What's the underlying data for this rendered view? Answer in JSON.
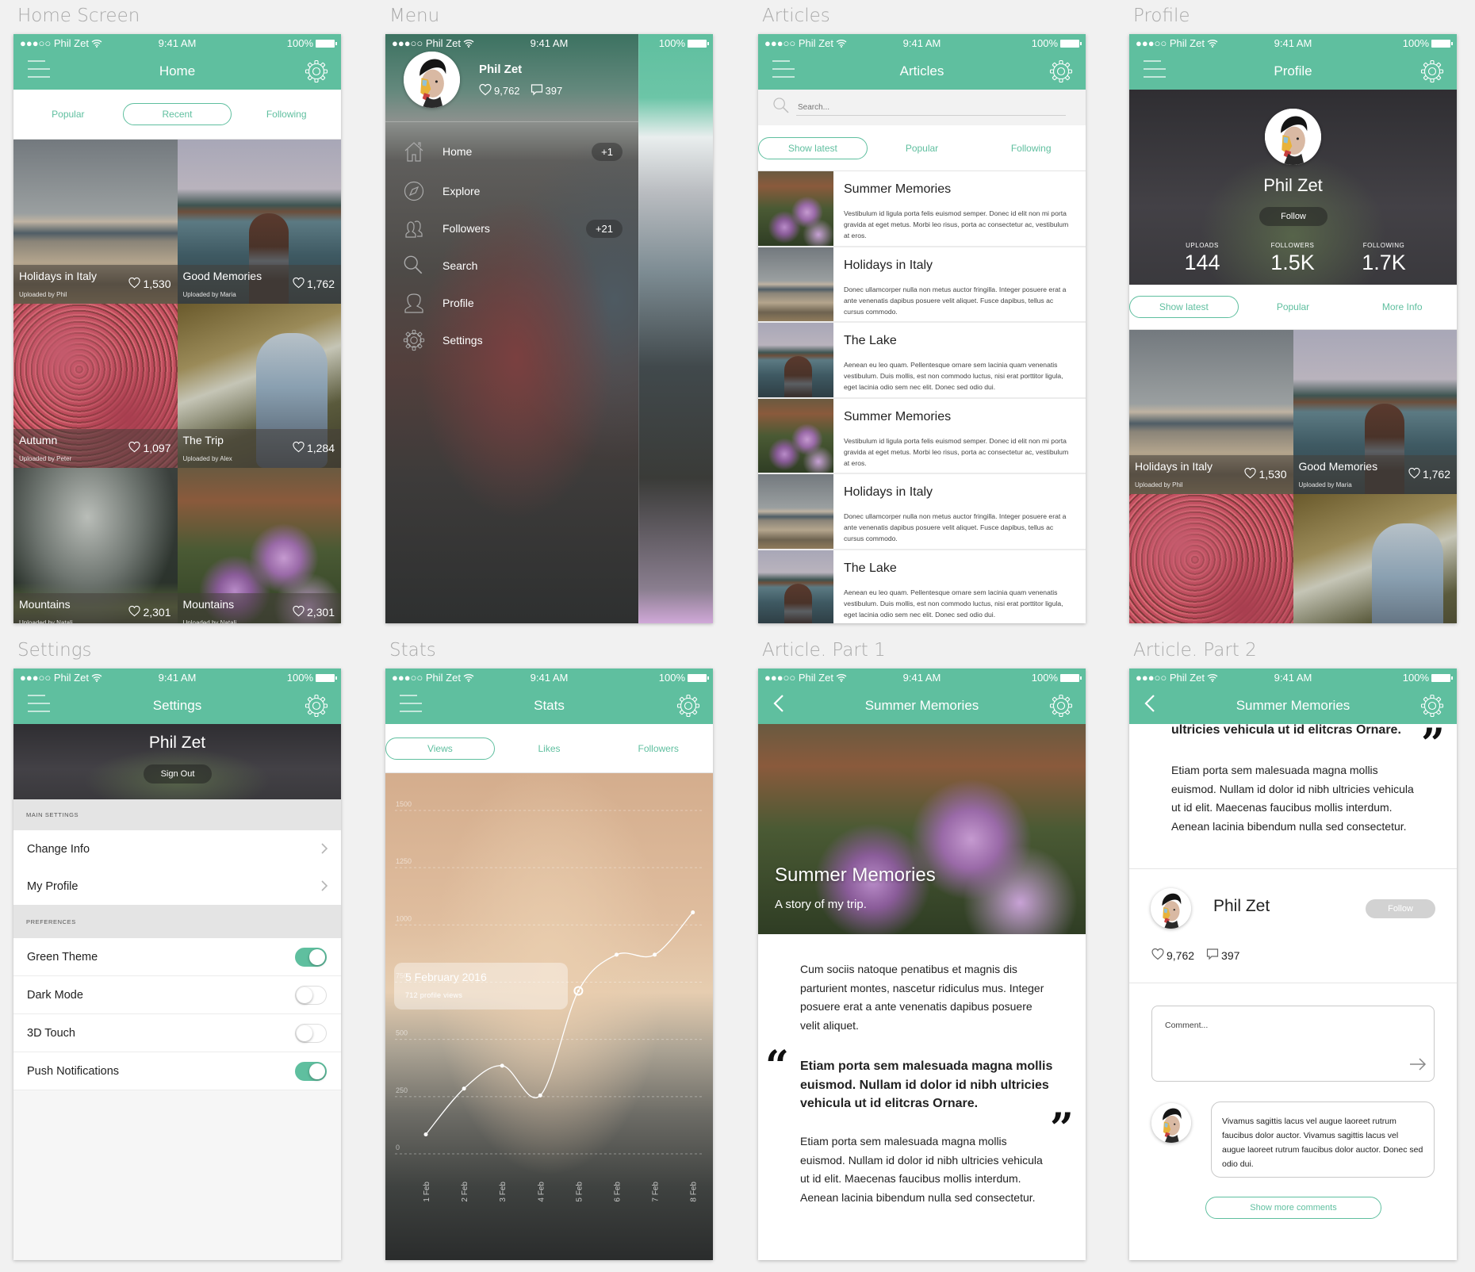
{
  "colors": {
    "accent": "#5fbf9f",
    "text": "#222222",
    "muted": "#a9a9a9"
  },
  "status": {
    "carrier": "●●●○○ Phil Zet",
    "time": "9:41 AM",
    "battery": "100%"
  },
  "user": {
    "name": "Phil Zet",
    "likes": "9,762",
    "comments": "397"
  },
  "home": {
    "label": "Home Screen",
    "title": "Home",
    "tabs": [
      "Popular",
      "Recent",
      "Following"
    ],
    "active_tab": "Recent",
    "cards": [
      {
        "title": "Holidays in Italy",
        "uploader": "Uploaded by Phil",
        "likes": "1,530",
        "photo": "italy"
      },
      {
        "title": "Good Memories",
        "uploader": "Uploaded by Maria",
        "likes": "1,762",
        "photo": "lake"
      },
      {
        "title": "Autumn",
        "uploader": "Uploaded by Peter",
        "likes": "1,097",
        "photo": "autumn"
      },
      {
        "title": "The Trip",
        "uploader": "Uploaded by Alex",
        "likes": "1,284",
        "photo": "trip"
      },
      {
        "title": "Mountains",
        "uploader": "Uploaded by Natali",
        "likes": "2,301",
        "photo": "mist"
      },
      {
        "title": "Mountains",
        "uploader": "Uploaded by Natali",
        "likes": "2,301",
        "photo": "flowers"
      }
    ]
  },
  "menu": {
    "label": "Menu",
    "items": [
      {
        "label": "Home",
        "icon": "home-icon",
        "badge": "+1"
      },
      {
        "label": "Explore",
        "icon": "compass-icon",
        "badge": ""
      },
      {
        "label": "Followers",
        "icon": "followers-icon",
        "badge": "+21"
      },
      {
        "label": "Search",
        "icon": "search-icon",
        "badge": ""
      },
      {
        "label": "Profile",
        "icon": "profile-icon",
        "badge": ""
      },
      {
        "label": "Settings",
        "icon": "gear-icon",
        "badge": ""
      }
    ]
  },
  "articles": {
    "label": "Articles",
    "title": "Articles",
    "search_placeholder": "Search...",
    "tabs": [
      "Show latest",
      "Popular",
      "Following"
    ],
    "active_tab": "Show latest",
    "items": [
      {
        "title": "Summer Memories",
        "text": "Vestibulum id ligula porta felis euismod semper. Donec id elit non mi porta gravida at eget metus. Morbi leo risus, porta ac consectetur ac, vestibulum at eros.",
        "photo": "flowers"
      },
      {
        "title": "Holidays in Italy",
        "text": "Donec ullamcorper nulla non metus auctor fringilla. Integer posuere erat a ante venenatis dapibus posuere velit aliquet. Fusce dapibus, tellus ac cursus commodo.",
        "photo": "italy"
      },
      {
        "title": "The Lake",
        "text": "Aenean eu leo quam. Pellentesque ornare sem lacinia quam venenatis vestibulum. Duis mollis, est non commodo luctus, nisi erat porttitor ligula, eget lacinia odio sem nec elit. Donec sed odio dui.",
        "photo": "lake"
      },
      {
        "title": "Summer Memories",
        "text": "Vestibulum id ligula porta felis euismod semper. Donec id elit non mi porta gravida at eget metus. Morbi leo risus, porta ac consectetur ac, vestibulum at eros.",
        "photo": "flowers"
      },
      {
        "title": "Holidays in Italy",
        "text": "Donec ullamcorper nulla non metus auctor fringilla. Integer posuere erat a ante venenatis dapibus posuere velit aliquet. Fusce dapibus, tellus ac cursus commodo.",
        "photo": "italy"
      },
      {
        "title": "The Lake",
        "text": "Aenean eu leo quam. Pellentesque ornare sem lacinia quam venenatis vestibulum. Duis mollis, est non commodo luctus, nisi erat porttitor ligula, eget lacinia odio sem nec elit. Donec sed odio dui.",
        "photo": "lake"
      }
    ]
  },
  "profile": {
    "label": "Profile",
    "title": "Profile",
    "follow": "Follow",
    "stats": [
      {
        "key": "UPLOADS",
        "value": "144"
      },
      {
        "key": "FOLLOWERS",
        "value": "1.5K"
      },
      {
        "key": "FOLLOWING",
        "value": "1.7K"
      }
    ],
    "tabs": [
      "Show latest",
      "Popular",
      "More Info"
    ],
    "active_tab": "Show latest",
    "cards": [
      {
        "title": "Holidays in Italy",
        "uploader": "Uploaded by Phil",
        "likes": "1,530",
        "photo": "italy"
      },
      {
        "title": "Good Memories",
        "uploader": "Uploaded by Maria",
        "likes": "1,762",
        "photo": "lake"
      },
      {
        "title": "",
        "uploader": "",
        "likes": "",
        "photo": "autumn"
      },
      {
        "title": "",
        "uploader": "",
        "likes": "",
        "photo": "trip"
      }
    ]
  },
  "settings": {
    "label": "Settings",
    "title": "Settings",
    "sign_out": "Sign Out",
    "main_header": "MAIN SETTINGS",
    "main_items": [
      "Change Info",
      "My Profile"
    ],
    "pref_header": "PREFERENCES",
    "toggles": [
      {
        "label": "Green Theme",
        "on": true
      },
      {
        "label": "Dark Mode",
        "on": false
      },
      {
        "label": "3D Touch",
        "on": false
      },
      {
        "label": "Push Notifications",
        "on": true
      }
    ]
  },
  "stats": {
    "label": "Stats",
    "title": "Stats",
    "tabs": [
      "Views",
      "Likes",
      "Followers"
    ],
    "active_tab": "Views",
    "tooltip": {
      "date": "5 February 2016",
      "value": "712 profile views"
    }
  },
  "chart_data": {
    "type": "line",
    "categories": [
      "1 Feb",
      "2 Feb",
      "3 Feb",
      "4 Feb",
      "5 Feb",
      "6 Feb",
      "7 Feb",
      "8 Feb"
    ],
    "series": [
      {
        "values": [
          85,
          285,
          385,
          255,
          712,
          870,
          870,
          1055
        ]
      }
    ],
    "yticks": [
      0,
      250,
      500,
      750,
      1000,
      1250,
      1500
    ],
    "ylim": [
      0,
      1500
    ],
    "grid": true,
    "highlight_index": 4,
    "smooth": true
  },
  "article1": {
    "label": "Article. Part 1",
    "title": "Summer Memories",
    "hero_title": "Summer Memories",
    "hero_subtitle": "A story of my trip.",
    "para1": "Cum sociis natoque penatibus et magnis dis parturient montes, nascetur ridiculus mus. Integer posuere erat a ante venenatis dapibus posuere velit aliquet.",
    "quote": "Etiam porta sem malesuada magna mollis euismod. Nullam id dolor id nibh ultricies vehicula ut id elitcras Ornare.",
    "para2": "Etiam porta sem malesuada magna mollis euismod. Nullam id dolor id nibh ultricies vehicula ut id elit. Maecenas faucibus mollis interdum. Aenean lacinia bibendum nulla sed consectetur."
  },
  "article2": {
    "label": "Article. Part 2",
    "title": "Summer Memories",
    "quote_tail": "ultricies vehicula ut id elitcras Ornare.",
    "para": "Etiam porta sem malesuada magna mollis euismod. Nullam id dolor id nibh ultricies vehicula ut id elit. Maecenas faucibus mollis interdum. Aenean lacinia bibendum nulla sed consectetur.",
    "follow": "Follow",
    "comment_placeholder": "Comment...",
    "comment": "Vivamus sagittis lacus vel augue laoreet rutrum faucibus dolor auctor. Vivamus sagittis lacus vel augue laoreet rutrum faucibus dolor auctor. Donec sed odio dui.",
    "show_more": "Show more comments"
  }
}
